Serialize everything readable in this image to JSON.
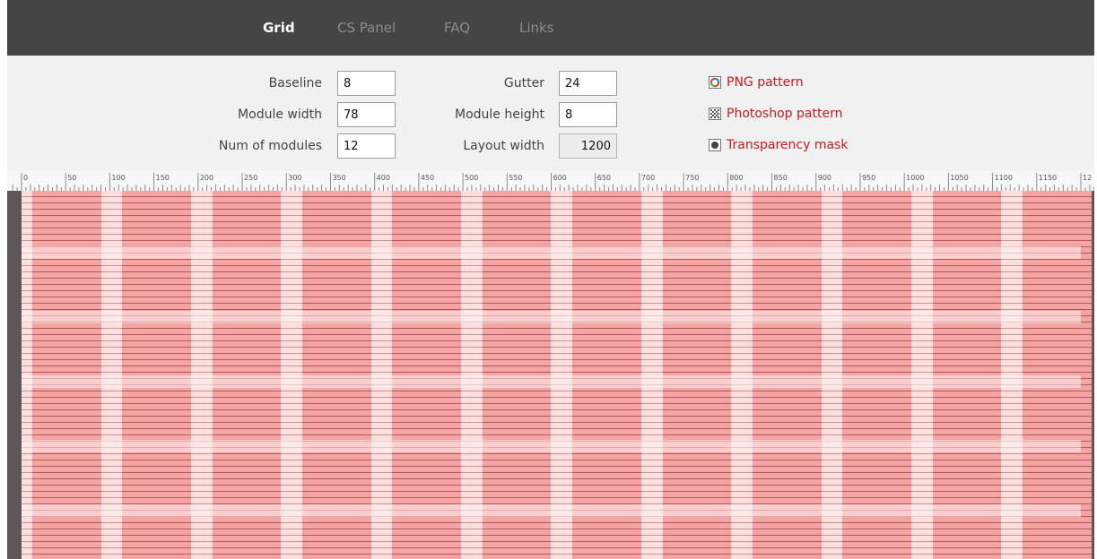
{
  "nav": {
    "items": [
      {
        "label": "Grid",
        "active": true
      },
      {
        "label": "CS Panel",
        "active": false
      },
      {
        "label": "FAQ",
        "active": false
      },
      {
        "label": "Links",
        "active": false
      }
    ]
  },
  "settings": {
    "baseline": {
      "label": "Baseline",
      "value": "8"
    },
    "module_width": {
      "label": "Module width",
      "value": "78"
    },
    "num_modules": {
      "label": "Num of modules",
      "value": "12"
    },
    "gutter": {
      "label": "Gutter",
      "value": "24"
    },
    "module_height": {
      "label": "Module height",
      "value": "8"
    },
    "layout_width": {
      "label": "Layout width",
      "value": "1200"
    }
  },
  "downloads": {
    "png": {
      "label": "PNG pattern",
      "icon": "png-icon"
    },
    "photoshop": {
      "label": "Photoshop pattern",
      "icon": "pattern-icon"
    },
    "mask": {
      "label": "Transparency mask",
      "icon": "mask-icon"
    }
  },
  "ruler": {
    "labels": [
      "0",
      "50",
      "100",
      "150",
      "200",
      "250",
      "300",
      "350",
      "400",
      "450",
      "500",
      "550",
      "600",
      "650",
      "700",
      "750",
      "800",
      "850",
      "900",
      "950",
      "1000",
      "1050",
      "1100",
      "1150",
      "12"
    ]
  },
  "colors": {
    "link": "#cc1a1a",
    "module": "#f5a3a3",
    "gutter": "#ffdede",
    "outside": "#5d5757",
    "header": "#454545"
  }
}
